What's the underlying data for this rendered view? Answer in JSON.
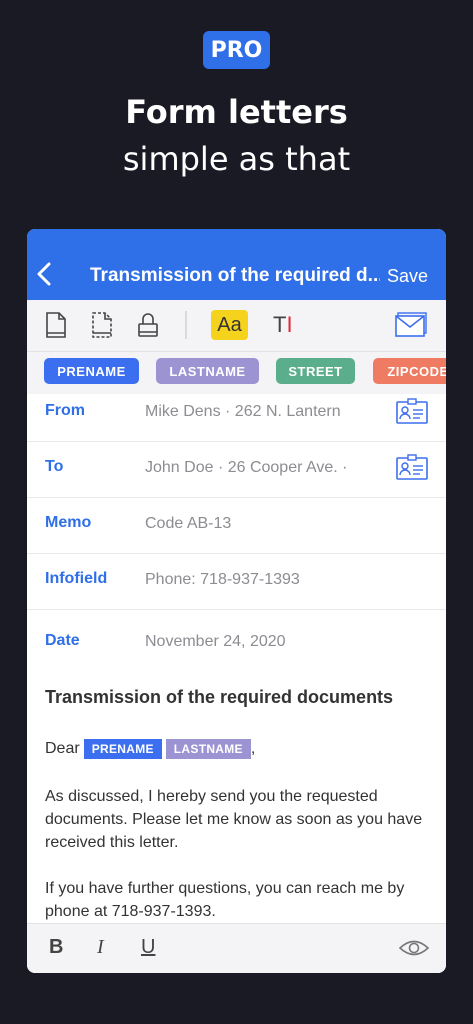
{
  "promo": {
    "badge": "PRO",
    "headline": "Form letters",
    "subheadline": "simple as that"
  },
  "navbar": {
    "title": "Transmission of the required d...",
    "save_label": "Save"
  },
  "toolbar": {
    "icons": [
      "document-icon",
      "document-dashed-icon",
      "lock-icon",
      "font-icon",
      "text-cursor-icon",
      "mail-icon"
    ],
    "font_label": "Aa",
    "text_label": "T"
  },
  "chips": [
    {
      "label": "PRENAME",
      "color": "#3b6ff0"
    },
    {
      "label": "LASTNAME",
      "color": "#9c93d3"
    },
    {
      "label": "STREET",
      "color": "#5bae8b"
    },
    {
      "label": "ZIPCODE",
      "color": "#ef7b62"
    }
  ],
  "fields": [
    {
      "label": "From",
      "value": "Mike Dens · 262 N. Lantern"
    },
    {
      "label": "To",
      "value": "John Doe · 26 Cooper Ave. ·"
    },
    {
      "label": "Memo",
      "value": "Code AB-13"
    },
    {
      "label": "Infofield",
      "value": "Phone: 718-937-1393"
    },
    {
      "label": "Date",
      "value": "November 24, 2020"
    }
  ],
  "letter": {
    "subject": "Transmission of the required documents",
    "salutation": "Dear",
    "chip_prename": "PRENAME",
    "chip_lastname": "LASTNAME",
    "comma": ",",
    "paragraph1": "As discussed, I hereby send you the requested documents. Please let me know as soon as you have received this letter.",
    "paragraph2": "If you have further questions, you can reach me by phone at 718-937-1393."
  },
  "format_bar": {
    "bold": "B",
    "italic": "I",
    "underline": "U"
  },
  "colors": {
    "accent": "#2f6fe8",
    "background": "#1a1a24",
    "highlight": "#f5d21b"
  }
}
